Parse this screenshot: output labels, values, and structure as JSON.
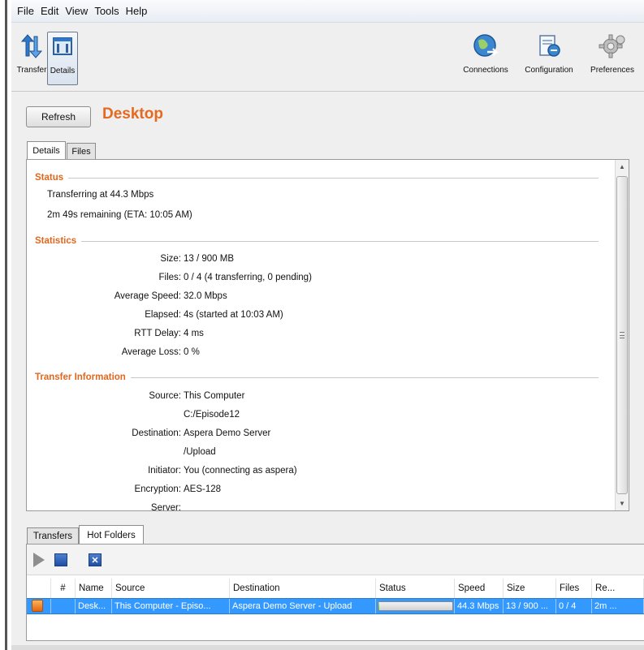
{
  "menu": [
    "File",
    "Edit",
    "View",
    "Tools",
    "Help"
  ],
  "toolbar": {
    "transfer": "Transfer",
    "details": "Details",
    "connections": "Connections",
    "configuration": "Configuration",
    "preferences": "Preferences"
  },
  "header": {
    "refresh": "Refresh",
    "title": "Desktop"
  },
  "tabs": {
    "details": "Details",
    "files": "Files"
  },
  "status": {
    "heading": "Status",
    "line1": "Transferring at 44.3 Mbps",
    "line2": "2m 49s remaining (ETA: 10:05 AM)"
  },
  "statistics": {
    "heading": "Statistics",
    "rows": [
      {
        "label": "Size:",
        "value": "13 / 900 MB"
      },
      {
        "label": "Files:",
        "value": "0 / 4 (4 transferring, 0 pending)"
      },
      {
        "label": "Average Speed:",
        "value": "32.0 Mbps"
      },
      {
        "label": "Elapsed:",
        "value": "4s (started at 10:03 AM)"
      },
      {
        "label": "RTT Delay:",
        "value": "4 ms"
      },
      {
        "label": "Average Loss:",
        "value": "0 %"
      }
    ]
  },
  "transfer_info": {
    "heading": "Transfer Information",
    "rows": [
      {
        "label": "Source:",
        "value": "This Computer"
      },
      {
        "label": "",
        "value": "C:/Episode12"
      },
      {
        "label": "Destination:",
        "value": "Aspera Demo Server"
      },
      {
        "label": "",
        "value": "/Upload"
      },
      {
        "label": "Initiator:",
        "value": "You (connecting as aspera)"
      },
      {
        "label": "Encryption:",
        "value": "AES-128"
      },
      {
        "label": "Server:",
        "value": ""
      }
    ]
  },
  "lower_tabs": {
    "transfers": "Transfers",
    "hot_folders": "Hot Folders"
  },
  "grid": {
    "columns": [
      "#",
      "Name",
      "Source",
      "Destination",
      "Status",
      "Speed",
      "Size",
      "Files",
      "Re..."
    ],
    "row": {
      "num": "",
      "name": "Desk...",
      "source": "This Computer - Episo...",
      "destination": "Aspera Demo Server - Upload",
      "progress": 0.015,
      "speed": "44.3 Mbps",
      "size": "13 / 900 ...",
      "files": "0 / 4",
      "remaining": "2m ..."
    }
  },
  "colors": {
    "accent": "#e46a20",
    "selection": "#3399ff"
  }
}
